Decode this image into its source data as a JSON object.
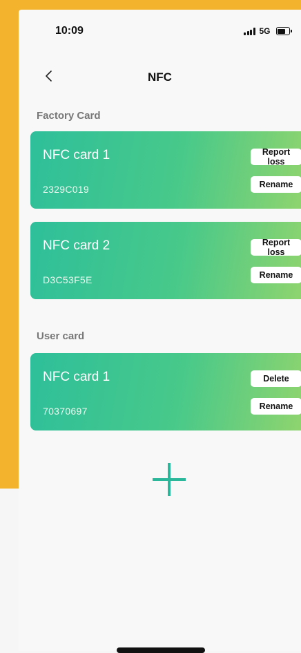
{
  "status_bar": {
    "time": "10:09",
    "network": "5G",
    "battery_level": 0.75
  },
  "nav": {
    "title": "NFC",
    "back_icon": "chevron-left-icon"
  },
  "sections": [
    {
      "title": "Factory Card",
      "cards": [
        {
          "name": "NFC card 1",
          "id": "2329C019",
          "primary_action": "Report loss",
          "secondary_action": "Rename"
        },
        {
          "name": "NFC card 2",
          "id": "D3C53F5E",
          "primary_action": "Report loss",
          "secondary_action": "Rename"
        }
      ]
    },
    {
      "title": "User card",
      "cards": [
        {
          "name": "NFC card 1",
          "id": "70370697",
          "primary_action": "Delete",
          "secondary_action": "Rename"
        }
      ]
    }
  ],
  "add_button": {
    "icon": "plus-icon"
  },
  "colors": {
    "accent": "#2bb89a",
    "card_start": "#2ebf9a",
    "card_end": "#8ed46e",
    "frame": "#f4b32c"
  }
}
